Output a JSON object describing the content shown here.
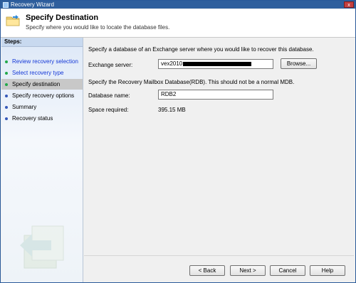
{
  "window": {
    "title": "Recovery Wizard",
    "close_label": "x"
  },
  "header": {
    "title": "Specify Destination",
    "subtitle": "Specify where you would like to locate the database files."
  },
  "sidebar": {
    "heading": "Steps:",
    "items": [
      {
        "label": "Review recovery selection",
        "state": "completed"
      },
      {
        "label": "Select recovery type",
        "state": "completed"
      },
      {
        "label": "Specify destination",
        "state": "current"
      },
      {
        "label": "Specify recovery options",
        "state": "pending"
      },
      {
        "label": "Summary",
        "state": "pending"
      },
      {
        "label": "Recovery status",
        "state": "pending"
      }
    ]
  },
  "main": {
    "intro": "Specify a database of an Exchange server where you would like to recover this database.",
    "exchange_server_label": "Exchange server:",
    "exchange_server_value": "vex2010",
    "browse_label": "Browse...",
    "rdb_note": "Specify the Recovery Mailbox Database(RDB). This should not be a normal MDB.",
    "database_name_label": "Database name:",
    "database_name_value": "RDB2",
    "space_required_label": "Space required:",
    "space_required_value": "395.15 MB"
  },
  "buttons": {
    "back": "< Back",
    "next": "Next >",
    "cancel": "Cancel",
    "help": "Help"
  },
  "colors": {
    "title_bar": "#2f5f9d",
    "link": "#1538d7",
    "completed_dot": "#22a84a",
    "pending_dot": "#3659b9",
    "active_step": "#c8c8c8"
  }
}
